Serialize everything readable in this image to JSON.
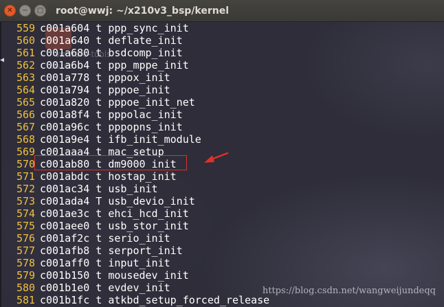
{
  "window": {
    "title": "root@wwj: ~/x210v3_bsp/kernel",
    "close_symbol": "✕",
    "minimize_symbol": "−",
    "maximize_symbol": "□"
  },
  "terminal": {
    "ghost_labels": [
      "vmware-tools",
      "distrib"
    ],
    "lines": [
      {
        "ln": "559",
        "text": "c001a604 t ppp_sync_init"
      },
      {
        "ln": "560",
        "text": "c001a640 t deflate_init"
      },
      {
        "ln": "561",
        "text": "c001a680 t bsdcomp_init"
      },
      {
        "ln": "562",
        "text": "c001a6b4 t ppp_mppe_init"
      },
      {
        "ln": "563",
        "text": "c001a778 t pppox_init"
      },
      {
        "ln": "564",
        "text": "c001a794 t pppoe_init"
      },
      {
        "ln": "565",
        "text": "c001a820 t pppoe_init_net"
      },
      {
        "ln": "566",
        "text": "c001a8f4 t pppolac_init"
      },
      {
        "ln": "567",
        "text": "c001a96c t pppopns_init"
      },
      {
        "ln": "568",
        "text": "c001a9e4 t ifb_init_module"
      },
      {
        "ln": "569",
        "text": "c001aaa4 t mac_setup"
      },
      {
        "ln": "570",
        "text": "c001ab80 t dm9000_init"
      },
      {
        "ln": "571",
        "text": "c001abdc t hostap_init"
      },
      {
        "ln": "572",
        "text": "c001ac34 t usb_init"
      },
      {
        "ln": "573",
        "text": "c001ada4 T usb_devio_init"
      },
      {
        "ln": "574",
        "text": "c001ae3c t ehci_hcd_init"
      },
      {
        "ln": "575",
        "text": "c001aee0 t usb_stor_init"
      },
      {
        "ln": "576",
        "text": "c001af2c t serio_init"
      },
      {
        "ln": "577",
        "text": "c001afb8 t serport_init"
      },
      {
        "ln": "578",
        "text": "c001aff0 t input_init"
      },
      {
        "ln": "579",
        "text": "c001b150 t mousedev_init"
      },
      {
        "ln": "580",
        "text": "c001b1e0 t evdev_init"
      },
      {
        "ln": "581",
        "text": "c001b1fc t atkbd_setup_forced_release"
      }
    ],
    "highlighted_line": "570",
    "highlight_color": "#e0302a",
    "line_number_color": "#f0c040",
    "text_color": "#ffffff"
  },
  "watermark": "https://blog.csdn.net/wangweijundeqq"
}
